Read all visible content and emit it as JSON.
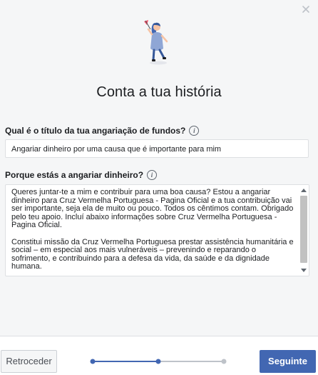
{
  "dialog": {
    "title": "Conta a tua história"
  },
  "title_field": {
    "label": "Qual é o título da tua angariação de fundos?",
    "value": "Angariar dinheiro por uma causa que é importante para mim"
  },
  "reason_field": {
    "label": "Porque estás a angariar dinheiro?",
    "paragraphs": [
      "Queres juntar-te a mim e contribuir para uma boa causa? Estou a angariar dinheiro para Cruz Vermelha Portuguesa - Pagina Oficial e a tua contribuição vai ser importante, seja ela de muito ou pouco. Todos os cêntimos contam. Obrigado pelo teu apoio. Incluí abaixo informações sobre Cruz Vermelha Portuguesa - Pagina Oficial.",
      "Constitui missão da Cruz Vermelha Portuguesa prestar assistência humanitária e social – em especial aos mais vulneráveis – prevenindo e reparando o sofrimento, e contribuindo para a defesa da vida, da saúde e da dignidade humana."
    ]
  },
  "info_icon_glyph": "i",
  "footer": {
    "back_label": "Retroceder",
    "next_label": "Seguinte",
    "progress": {
      "total_steps": 3,
      "current_step": 2
    }
  },
  "colors": {
    "accent": "#4267b2",
    "inactive_step": "#bec3c9"
  },
  "icons": [
    "close-icon",
    "illustration-woman-with-flag",
    "info-icon"
  ]
}
